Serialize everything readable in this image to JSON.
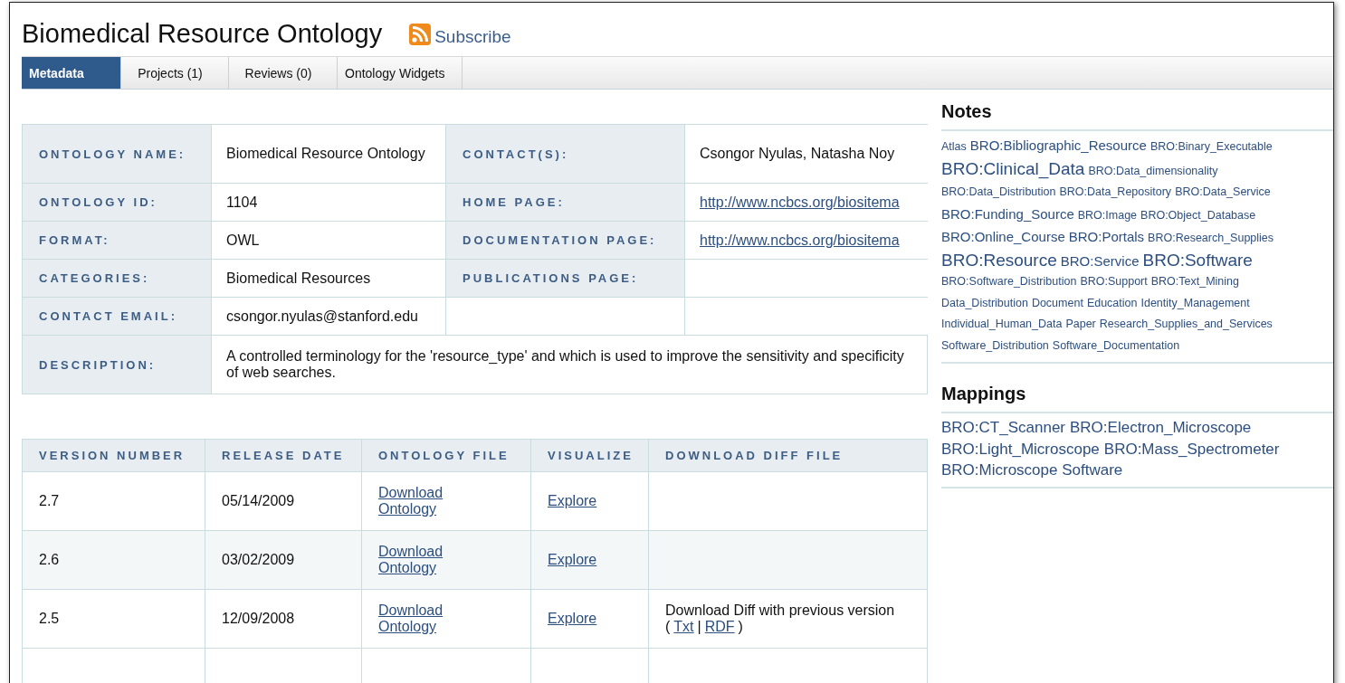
{
  "title": "Biomedical Resource Ontology",
  "subscribe": "Subscribe",
  "tabs": [
    {
      "label": "Metadata",
      "selected": true
    },
    {
      "label": "Projects (1)",
      "selected": false
    },
    {
      "label": "Reviews (0)",
      "selected": false
    },
    {
      "label": "Ontology Widgets",
      "selected": false
    }
  ],
  "metadata": [
    {
      "kind": "text",
      "label": "ONTOLOGY NAME:",
      "value": "Biomedical Resource Ontology",
      "label2": "CONTACT(S):",
      "value2": "Csongor Nyulas, Natasha Noy"
    },
    {
      "kind": "link",
      "label": "ONTOLOGY ID:",
      "value": "1104",
      "label2": "HOME PAGE:",
      "value2": "http://www.ncbcs.org/biositema"
    },
    {
      "kind": "link",
      "label": "FORMAT:",
      "value": "OWL",
      "label2": "DOCUMENTATION PAGE:",
      "value2": "http://www.ncbcs.org/biositema"
    },
    {
      "kind": "label",
      "label": "CATEGORIES:",
      "value": "Biomedical Resources",
      "label2": "PUBLICATIONS PAGE:"
    },
    {
      "kind": "single",
      "label": "CONTACT EMAIL:",
      "value": "csongor.nyulas@stanford.edu"
    },
    {
      "kind": "wide",
      "label": "DESCRIPTION:",
      "value": "A controlled terminology for the 'resource_type' and which is used to improve the sensitivity and specificity of web searches."
    }
  ],
  "versions": {
    "columns": [
      "VERSION NUMBER",
      "RELEASE DATE",
      "ONTOLOGY FILE",
      "VISUALIZE",
      "DOWNLOAD DIFF FILE"
    ],
    "rows": [
      {
        "version": "2.7",
        "date": "05/14/2009",
        "file": "Download Ontology",
        "visualize": "Explore"
      },
      {
        "version": "2.6",
        "date": "03/02/2009",
        "file": "Download Ontology",
        "visualize": "Explore"
      },
      {
        "version": "2.5",
        "date": "12/09/2008",
        "file": "Download Ontology",
        "visualize": "Explore",
        "diff": {
          "text": "Download Diff with previous version",
          "open": "(",
          "links": [
            "Txt",
            "RDF"
          ],
          "separator": "|",
          "close": ")"
        }
      }
    ]
  },
  "notes": {
    "heading": "Notes",
    "lines": [
      [
        {
          "text": "Atlas",
          "kind": "small"
        },
        {
          "text": "BRO:Bibliographic_Resource",
          "kind": "medium"
        },
        {
          "text": "BRO:Binary_Executable",
          "kind": "small"
        }
      ],
      [
        {
          "text": "BRO:Clinical_Data",
          "kind": "large"
        },
        {
          "text": "BRO:Data_dimensionality",
          "kind": "small"
        }
      ],
      [
        {
          "text": "BRO:Data_Distribution",
          "kind": "small"
        },
        {
          "text": "BRO:Data_Repository",
          "kind": "small"
        },
        {
          "text": "BRO:Data_Service",
          "kind": "small"
        }
      ],
      [
        {
          "text": "BRO:Funding_Source",
          "kind": "medium"
        },
        {
          "text": "BRO:Image",
          "kind": "small"
        },
        {
          "text": "BRO:Object_Database",
          "kind": "small"
        }
      ],
      [
        {
          "text": "BRO:Online_Course",
          "kind": "medium"
        },
        {
          "text": "BRO:Portals",
          "kind": "medium"
        },
        {
          "text": "BRO:Research_Supplies",
          "kind": "small"
        }
      ],
      [
        {
          "text": "BRO:Resource",
          "kind": "large"
        },
        {
          "text": "BRO:Service",
          "kind": "medium"
        },
        {
          "text": "BRO:Software",
          "kind": "large"
        }
      ],
      [
        {
          "text": "BRO:Software_Distribution",
          "kind": "small"
        },
        {
          "text": "BRO:Support",
          "kind": "small"
        },
        {
          "text": "BRO:Text_Mining",
          "kind": "small"
        }
      ],
      [
        {
          "text": "Data_Distribution",
          "kind": "small"
        },
        {
          "text": "Document",
          "kind": "small"
        },
        {
          "text": "Education",
          "kind": "small"
        },
        {
          "text": "Identity_Management",
          "kind": "small"
        }
      ],
      [
        {
          "text": "Individual_Human_Data",
          "kind": "small"
        },
        {
          "text": "Paper",
          "kind": "small"
        },
        {
          "text": "Research_Supplies_and_Services",
          "kind": "small"
        }
      ],
      [
        {
          "text": "Software_Distribution",
          "kind": "small"
        },
        {
          "text": "Software_Documentation",
          "kind": "small"
        }
      ]
    ]
  },
  "mappings": {
    "heading": "Mappings",
    "lines": [
      [
        "BRO:CT_Scanner",
        "BRO:Electron_Microscope"
      ],
      [
        "BRO:Light_Microscope",
        "BRO:Mass_Spectrometer"
      ],
      [
        "BRO:Microscope Software"
      ]
    ]
  }
}
